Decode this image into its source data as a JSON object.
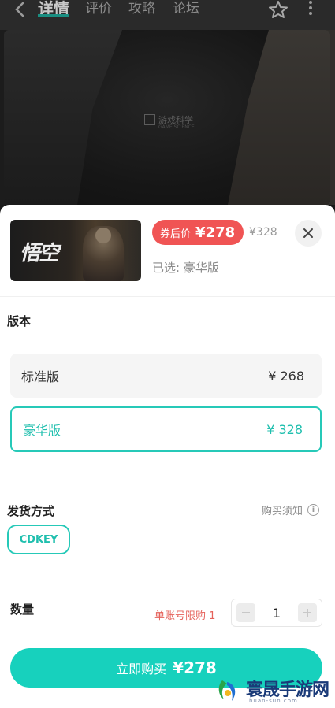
{
  "nav": {
    "tabs": [
      "详情",
      "评价",
      "攻略",
      "论坛"
    ]
  },
  "hero": {
    "watermark": "游戏科学",
    "watermark_sub": "GAME SCIENCE"
  },
  "product": {
    "thumb_title": "悟空",
    "coupon_label": "券后价",
    "coupon_price": "¥278",
    "original_price": "¥328",
    "selected_label": "已选:",
    "selected_value": "豪华版"
  },
  "edition": {
    "title": "版本",
    "options": [
      {
        "name": "标准版",
        "price": "¥ 268",
        "selected": false
      },
      {
        "name": "豪华版",
        "price": "¥ 328",
        "selected": true
      }
    ]
  },
  "delivery": {
    "title": "发货方式",
    "notice": "购买须知",
    "method": "CDKEY"
  },
  "quantity": {
    "title": "数量",
    "limit": "单账号限购 1",
    "value": "1"
  },
  "buy": {
    "label": "立即购买",
    "price": "¥278"
  },
  "site_logo": {
    "name": "寰晟手游网",
    "domain": "huan-sun.com"
  },
  "colors": {
    "accent": "#17d1bd",
    "selected_border": "#26c9b8",
    "coupon": "#f05454",
    "limit_text": "#e5615a"
  }
}
